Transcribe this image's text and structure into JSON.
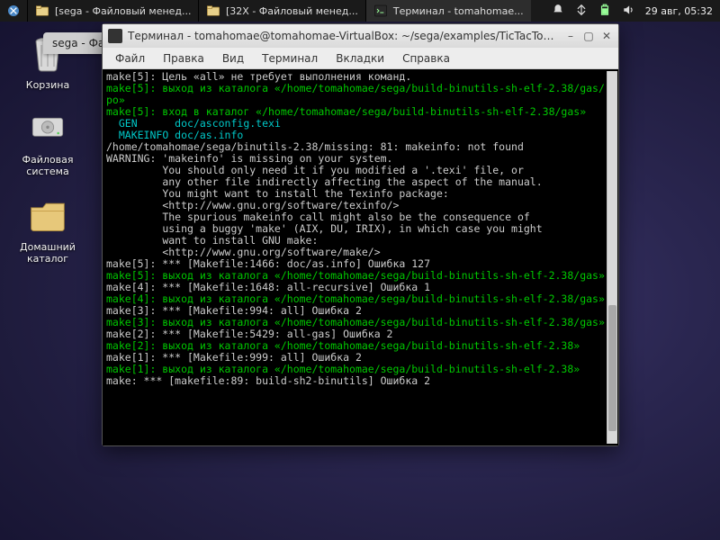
{
  "taskbar": {
    "items": [
      {
        "label": "[sega - Файловый менед..."
      },
      {
        "label": "[32X - Файловый менед..."
      },
      {
        "label": "Терминал - tomahomae..."
      }
    ],
    "clock": "29 авг, 05:32"
  },
  "desktop": {
    "icons": [
      {
        "label": "Корзина"
      },
      {
        "label": "Файловая система"
      },
      {
        "label": "Домашний каталог"
      }
    ]
  },
  "fm_tab": "sega - Файловый менеджер",
  "terminal": {
    "title": "Терминал - tomahomae@tomahomae-VirtualBox: ~/sega/examples/TicTacToe/C",
    "menu": [
      "Файл",
      "Правка",
      "Вид",
      "Терминал",
      "Вкладки",
      "Справка"
    ]
  },
  "lines": {
    "l00": "make[5]: Цель «all» не требует выполнения команд.",
    "l01a": "make[5]: выход из каталога «/home/tomahomae/sega/build-binutils-sh-elf-2.38/gas/",
    "l01b": "po»",
    "l02a": "make[5]: вход в каталог «/home/tomahomae/sega/build-binutils-sh-elf-2.38/gas»",
    "l03": "  GEN      doc/asconfig.texi",
    "l04": "  MAKEINFO doc/as.info",
    "l05": "/home/tomahomae/sega/binutils-2.38/missing: 81: makeinfo: not found",
    "l06": "WARNING: 'makeinfo' is missing on your system.",
    "l07": "         You should only need it if you modified a '.texi' file, or",
    "l08": "         any other file indirectly affecting the aspect of the manual.",
    "l09": "         You might want to install the Texinfo package:",
    "l10": "         <http://www.gnu.org/software/texinfo/>",
    "l11": "         The spurious makeinfo call might also be the consequence of",
    "l12": "         using a buggy 'make' (AIX, DU, IRIX), in which case you might",
    "l13": "         want to install GNU make:",
    "l14": "         <http://www.gnu.org/software/make/>",
    "l15": "make[5]: *** [Makefile:1466: doc/as.info] Ошибка 127",
    "l16": "make[5]: выход из каталога «/home/tomahomae/sega/build-binutils-sh-elf-2.38/gas»",
    "l17": "make[4]: *** [Makefile:1648: all-recursive] Ошибка 1",
    "l18": "make[4]: выход из каталога «/home/tomahomae/sega/build-binutils-sh-elf-2.38/gas»",
    "l19": "make[3]: *** [Makefile:994: all] Ошибка 2",
    "l20": "make[3]: выход из каталога «/home/tomahomae/sega/build-binutils-sh-elf-2.38/gas»",
    "l21": "make[2]: *** [Makefile:5429: all-gas] Ошибка 2",
    "l22": "make[2]: выход из каталога «/home/tomahomae/sega/build-binutils-sh-elf-2.38»",
    "l23": "make[1]: *** [Makefile:999: all] Ошибка 2",
    "l24": "make[1]: выход из каталога «/home/tomahomae/sega/build-binutils-sh-elf-2.38»",
    "l25": "make: *** [makefile:89: build-sh2-binutils] Ошибка 2"
  }
}
